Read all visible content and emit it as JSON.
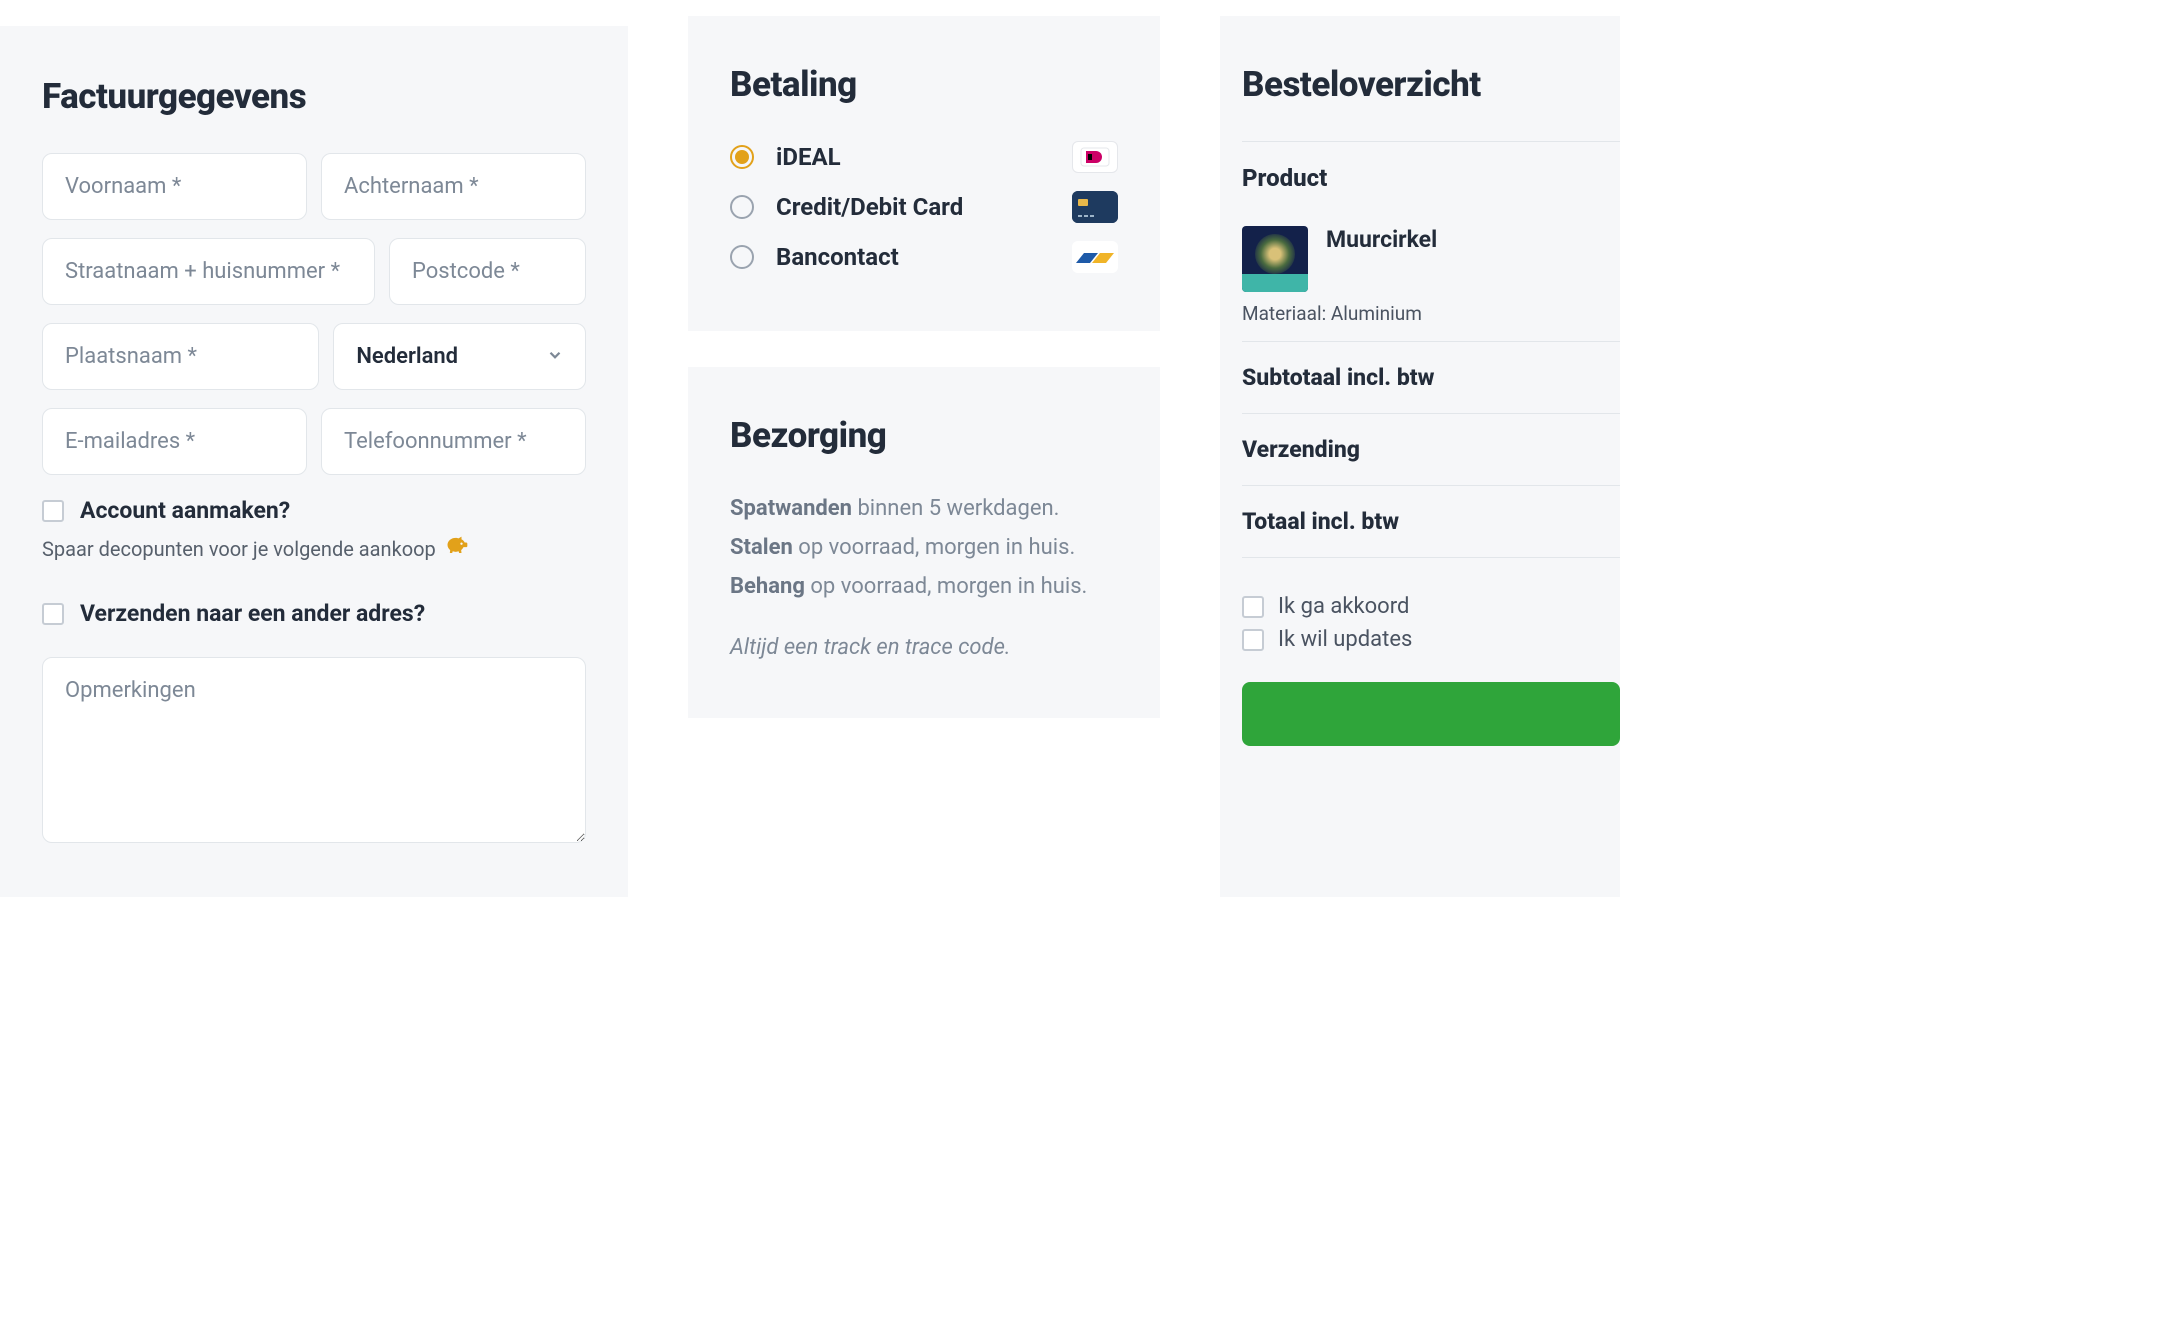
{
  "billing": {
    "title": "Factuurgegevens",
    "firstname_ph": "Voornaam *",
    "lastname_ph": "Achternaam *",
    "street_ph": "Straatnaam + huisnummer *",
    "postcode_ph": "Postcode *",
    "city_ph": "Plaatsnaam *",
    "country_value": "Nederland",
    "email_ph": "E-mailadres *",
    "phone_ph": "Telefoonnummer *",
    "create_account_label": "Account aanmaken?",
    "create_account_sub": "Spaar decopunten voor je volgende aankoop",
    "ship_other_label": "Verzenden naar een ander adres?",
    "notes_ph": "Opmerkingen"
  },
  "payment": {
    "title": "Betaling",
    "options": [
      {
        "label": "iDEAL",
        "selected": true
      },
      {
        "label": "Credit/Debit Card",
        "selected": false
      },
      {
        "label": "Bancontact",
        "selected": false
      }
    ]
  },
  "delivery": {
    "title": "Bezorging",
    "lines": [
      {
        "b": "Spatwanden",
        "rest": " binnen 5 werkdagen."
      },
      {
        "b": "Stalen",
        "rest": " op voorraad, morgen in huis."
      },
      {
        "b": "Behang",
        "rest": " op voorraad, morgen in huis."
      }
    ],
    "note": "Altijd een track en trace code."
  },
  "summary": {
    "title": "Besteloverzicht",
    "product_header": "Product",
    "product_name": "Muurcirkel",
    "product_meta": "Materiaal: Aluminium",
    "subtotal_label": "Subtotaal incl. btw",
    "shipping_label": "Verzending",
    "total_label": "Totaal incl. btw",
    "agree_label": "Ik ga akkoord",
    "updates_label": "Ik wil updates",
    "order_button": ""
  }
}
